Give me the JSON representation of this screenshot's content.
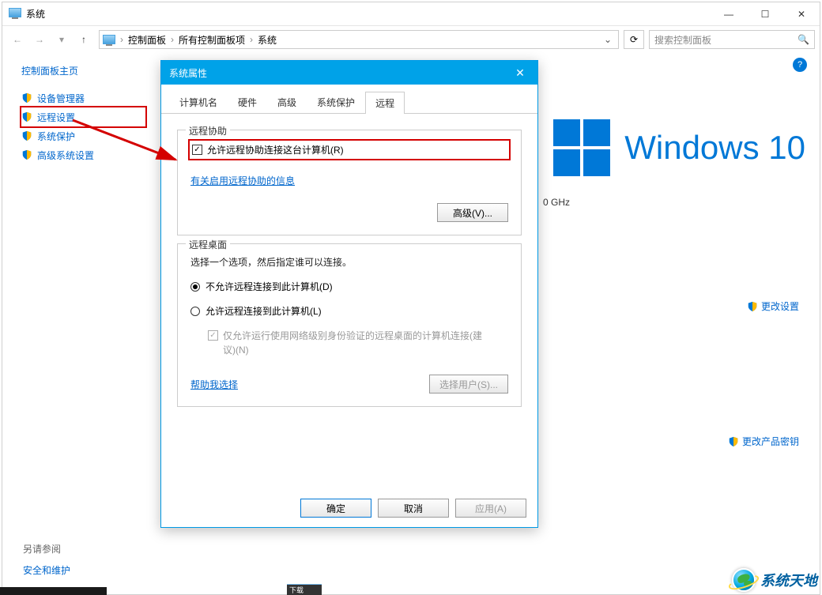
{
  "window": {
    "title": "系统",
    "breadcrumbs": [
      "控制面板",
      "所有控制面板项",
      "系统"
    ],
    "search_placeholder": "搜索控制面板"
  },
  "sidebar": {
    "home": "控制面板主页",
    "items": [
      {
        "label": "设备管理器"
      },
      {
        "label": "远程设置"
      },
      {
        "label": "系统保护"
      },
      {
        "label": "高级系统设置"
      }
    ],
    "see_also": "另请参阅",
    "see_also_link": "安全和维护"
  },
  "main": {
    "brand": "Windows 10",
    "cpu_tail": "0 GHz",
    "change_settings": "更改设置",
    "change_product_key": "更改产品密钥"
  },
  "dialog": {
    "title": "系统属性",
    "tabs": [
      "计算机名",
      "硬件",
      "高级",
      "系统保护",
      "远程"
    ],
    "remote_assist": {
      "legend": "远程协助",
      "checkbox": "允许远程协助连接这台计算机(R)",
      "info_link": "有关启用远程协助的信息",
      "advanced_btn": "高级(V)..."
    },
    "remote_desktop": {
      "legend": "远程桌面",
      "desc": "选择一个选项，然后指定谁可以连接。",
      "opt_disallow": "不允许远程连接到此计算机(D)",
      "opt_allow": "允许远程连接到此计算机(L)",
      "nla_checkbox": "仅允许运行使用网络级别身份验证的远程桌面的计算机连接(建议)(N)",
      "help_link": "帮助我选择",
      "select_users_btn": "选择用户(S)..."
    },
    "buttons": {
      "ok": "确定",
      "cancel": "取消",
      "apply": "应用(A)"
    }
  },
  "watermark": "系统天地",
  "taskfrag": "下载"
}
